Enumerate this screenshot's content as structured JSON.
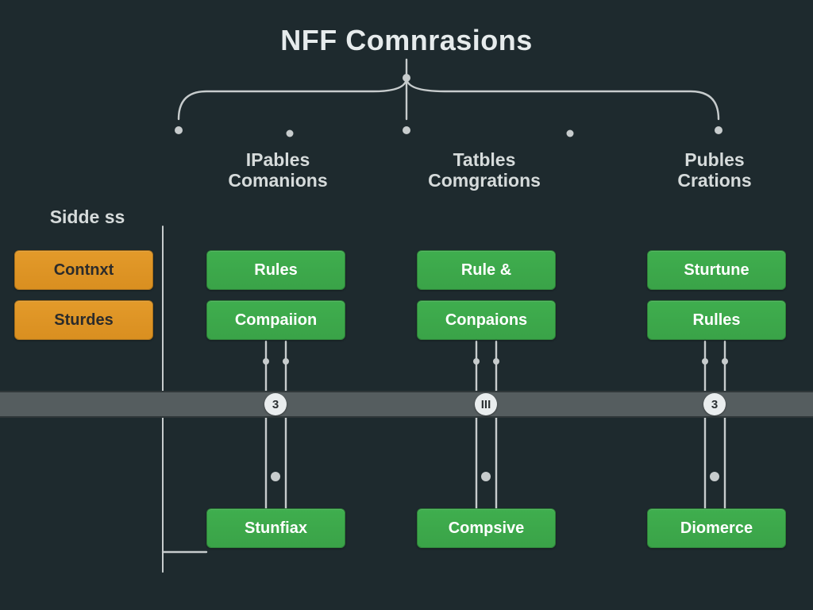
{
  "title": "NFF Comnrasions",
  "columns": {
    "c0": {
      "line1": "Sidde ss"
    },
    "c1": {
      "line1": "IPables",
      "line2": "Comanions"
    },
    "c2": {
      "line1": "Tatbles",
      "line2": "Comgrations"
    },
    "c3": {
      "line1": "Publes",
      "line2": "Crations"
    }
  },
  "side": {
    "a": "Contnxt",
    "b": "Sturdes"
  },
  "grid": {
    "c1": {
      "r1": "Rules",
      "r2": "Compaiion",
      "r3": "Stunfiax"
    },
    "c2": {
      "r1": "Rule &",
      "r2": "Conpaions",
      "r3": "Compsive"
    },
    "c3": {
      "r1": "Sturtune",
      "r2": "Rulles",
      "r3": "Diomerce"
    }
  },
  "badges": {
    "b1": "3",
    "b2": "III",
    "b3": "3"
  }
}
